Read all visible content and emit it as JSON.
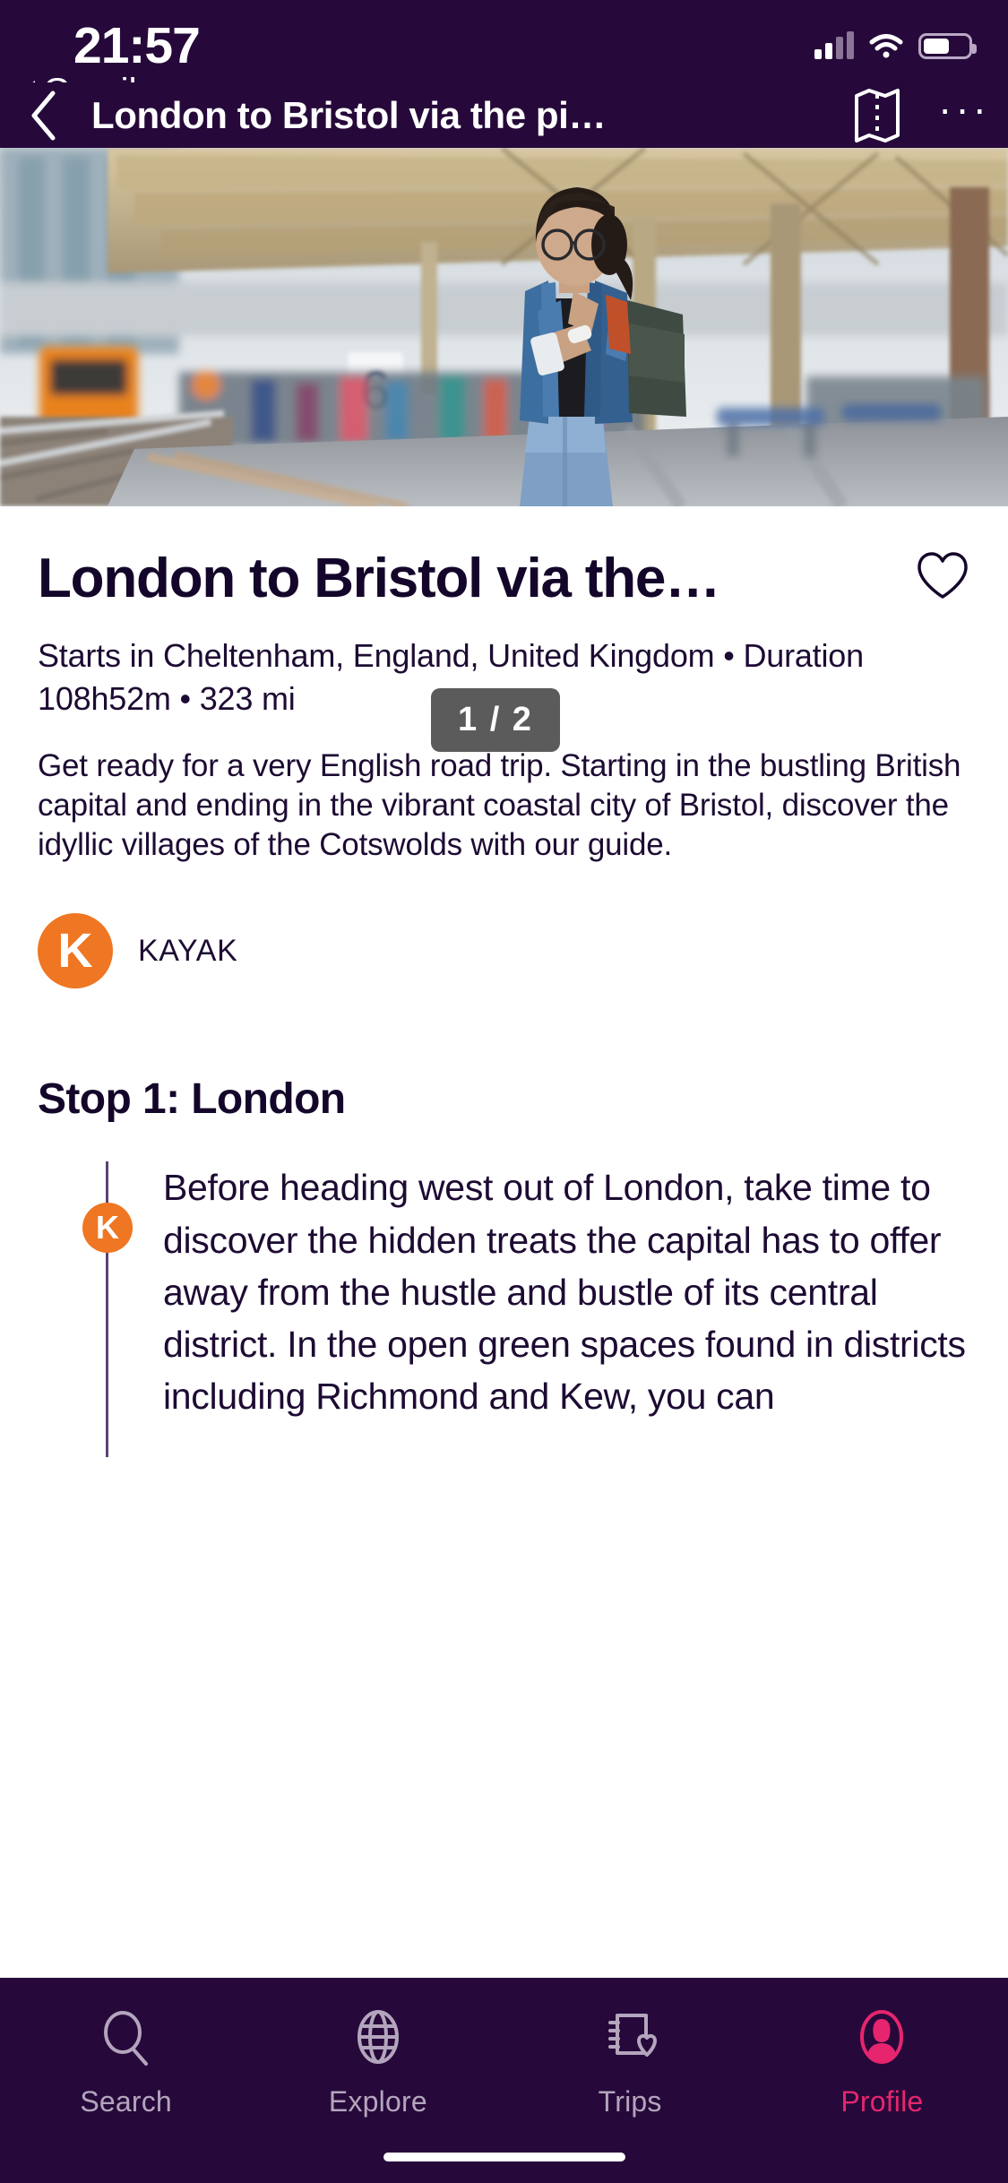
{
  "status_bar": {
    "time": "21:57",
    "back_app": "Gmail",
    "signal_icon": "cellular-bars-icon",
    "wifi_icon": "wifi-icon",
    "battery_icon": "battery-icon"
  },
  "nav_bar": {
    "back_icon": "chevron-left-icon",
    "title": "London to Bristol via the pi…",
    "map_icon": "map-icon",
    "more_icon": "overflow-menu-icon"
  },
  "hero": {
    "counter": "1 / 2",
    "platform_number": "6",
    "alt": "woman on train station platform"
  },
  "trip": {
    "title": "London to Bristol via the…",
    "favorite_icon": "heart-outline-icon",
    "meta": "Starts in Cheltenham, England, United Kingdom • Duration 108h52m • 323 mi",
    "description": "Get ready for a very English road trip. Starting in the bustling British capital and ending in the vibrant coastal city of Bristol, discover the idyllic villages of the Cotswolds with our guide.",
    "author": {
      "initial": "K",
      "name": "KAYAK",
      "color": "#ef7622"
    }
  },
  "stop": {
    "heading": "Stop 1: London",
    "badge_initial": "K",
    "body": "Before heading west out of London, take time to discover the hidden treats the capital has to offer away from the hustle and bustle of its central district. In the open green spaces found in districts including Richmond and Kew, you can"
  },
  "tab_bar": {
    "active_color": "#e6256e",
    "inactive_color": "#b3a5bd",
    "items": [
      {
        "label": "Search",
        "icon": "search-icon",
        "active": false
      },
      {
        "label": "Explore",
        "icon": "globe-icon",
        "active": false
      },
      {
        "label": "Trips",
        "icon": "trips-icon",
        "active": false
      },
      {
        "label": "Profile",
        "icon": "profile-icon",
        "active": true
      }
    ]
  },
  "theme": {
    "header_bg": "#26093a",
    "text_dark": "#14062a",
    "accent_orange": "#ef7622",
    "accent_pink": "#e6256e"
  }
}
